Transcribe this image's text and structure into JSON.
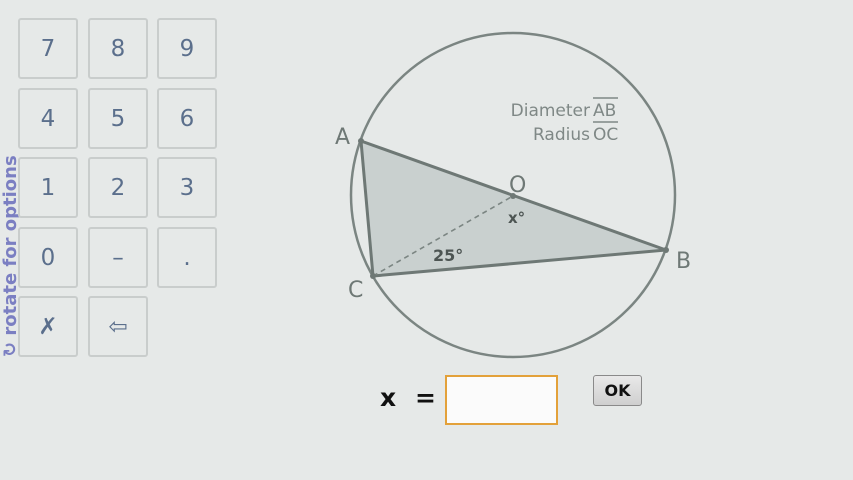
{
  "side_hint": "↻ rotate for options",
  "keypad": {
    "keys": [
      "7",
      "8",
      "9",
      "4",
      "5",
      "6",
      "1",
      "2",
      "3",
      "0",
      "–",
      ".",
      "✗",
      "⇦"
    ]
  },
  "figure": {
    "note_diameter_prefix": "Diameter",
    "note_diameter_segment": "AB",
    "note_radius_prefix": "Radius",
    "note_radius_segment": "OC",
    "point_a": "A",
    "point_b": "B",
    "point_c": "C",
    "point_o": "O",
    "angle_c": "25°",
    "angle_o": "x°"
  },
  "answer": {
    "variable": "x",
    "equals": "=",
    "value": "",
    "ok_label": "OK"
  },
  "colors": {
    "background": "#e6e9e8",
    "key_text": "#5b6f8c",
    "hint": "#7b7fc2",
    "triangle_fill": "#c9d0cf",
    "figure_line": "#7b8582",
    "input_border": "#e3a13a"
  }
}
